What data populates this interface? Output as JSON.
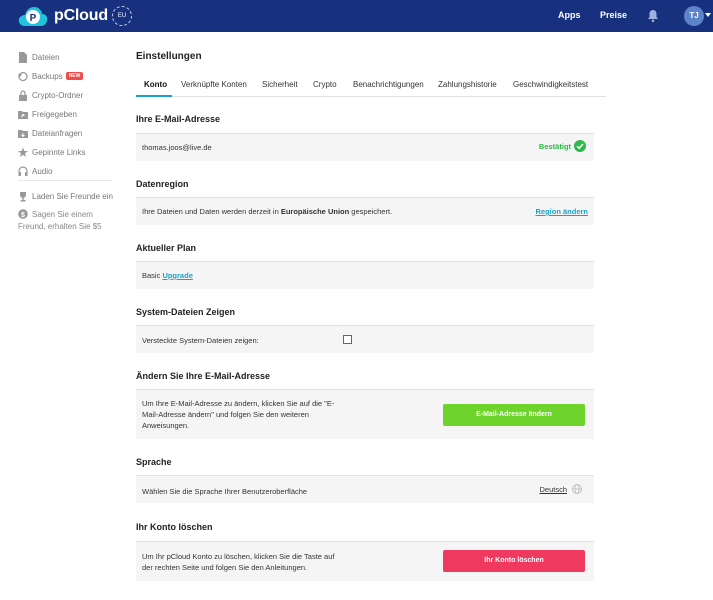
{
  "topbar": {
    "brand": "pCloud",
    "eu_badge": "EU",
    "apps_label": "Apps",
    "pricing_label": "Preise",
    "avatar_initials": "TJ",
    "bg_color": "#17317f"
  },
  "sidebar": {
    "items": [
      {
        "label": "Dateien",
        "icon": "file-icon"
      },
      {
        "label": "Backups",
        "icon": "backup-icon",
        "badge": "NEW"
      },
      {
        "label": "Crypto-Ordner",
        "icon": "lock-icon"
      },
      {
        "label": "Freigegeben",
        "icon": "shared-folder-icon"
      },
      {
        "label": "Dateianfragen",
        "icon": "folder-request-icon"
      },
      {
        "label": "Gepinnte Links",
        "icon": "star-icon"
      },
      {
        "label": "Audio",
        "icon": "headphones-icon"
      }
    ],
    "invite_friends": "Laden Sie Freunde ein",
    "invite_reward": "Sagen Sie einem Freund, erhalten Sie $5"
  },
  "main": {
    "title": "Einstellungen",
    "tabs": [
      {
        "label": "Konto",
        "active": true
      },
      {
        "label": "Verknüpfte Konten",
        "active": false
      },
      {
        "label": "Sicherheit",
        "active": false
      },
      {
        "label": "Crypto",
        "active": false
      },
      {
        "label": "Benachrichtigungen",
        "active": false
      },
      {
        "label": "Zahlungshistorie",
        "active": false
      },
      {
        "label": "Geschwindigkeitstest",
        "active": false
      }
    ],
    "email_section": {
      "title": "Ihre E-Mail-Adresse",
      "email": "thomas.joos@live.de",
      "status": "Bestätigt"
    },
    "region_section": {
      "title": "Datenregion",
      "text_before": "Ihre Dateien und Daten werden derzeit in ",
      "region": "Europäische Union",
      "text_after": " gespeichert.",
      "change_link": "Region ändern"
    },
    "plan_section": {
      "title": "Aktueller Plan",
      "plan": "Basic",
      "upgrade_link": "Upgrade"
    },
    "system_files_section": {
      "title": "System-Dateien Zeigen",
      "label": "Versteckte System-Dateien zeigen:",
      "checked": false
    },
    "change_email_section": {
      "title": "Ändern Sie Ihre E-Mail-Adresse",
      "text": "Um Ihre E-Mail-Adresse zu ändern, klicken Sie auf die \"E-Mail-Adresse ändern\" und folgen Sie den weiteren Anweisungen.",
      "button": "E-Mail-Adresse ändern",
      "button_color": "#6ed32a"
    },
    "language_section": {
      "title": "Sprache",
      "text": "Wählen Sie die Sprache Ihrer Benutzeroberfläche",
      "current_language": "Deutsch"
    },
    "delete_section": {
      "title": "Ihr Konto löschen",
      "text": "Um Ihr pCloud Konto zu löschen, klicken Sie die Taste auf der rechten Seite und folgen Sie den Anleitungen.",
      "button": "Ihr Konto löschen",
      "button_color": "#f0395f"
    }
  }
}
